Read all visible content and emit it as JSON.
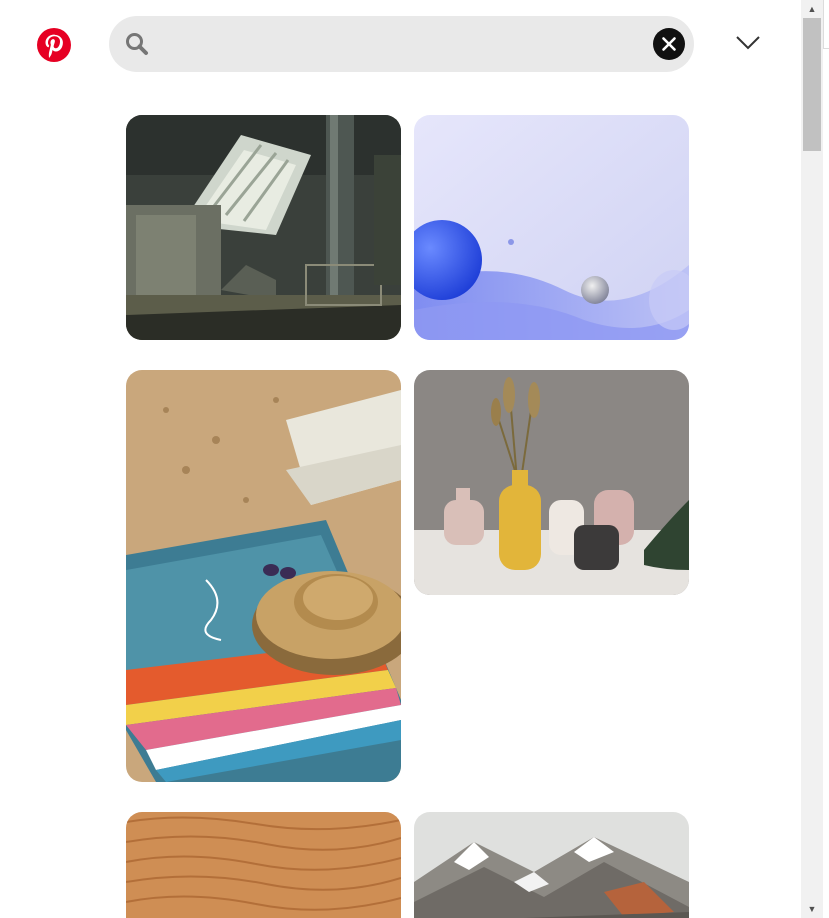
{
  "header": {
    "logo_icon": "pinterest-logo",
    "brand_color": "#e60023",
    "search": {
      "value": "",
      "placeholder": "",
      "icon": "search-icon",
      "clear_icon": "close-icon"
    },
    "menu_icon": "chevron-down-icon"
  },
  "pins": [
    {
      "subject": "subway-station-escalator"
    },
    {
      "subject": "blue-abstract-spheres"
    },
    {
      "subject": "beach-towel-straw-hat"
    },
    {
      "subject": "vases-dried-flowers"
    },
    {
      "subject": "sand-dunes"
    },
    {
      "subject": "snowy-mountains"
    }
  ],
  "scrollbar": {
    "up_arrow": "▲",
    "down_arrow": "▼"
  }
}
